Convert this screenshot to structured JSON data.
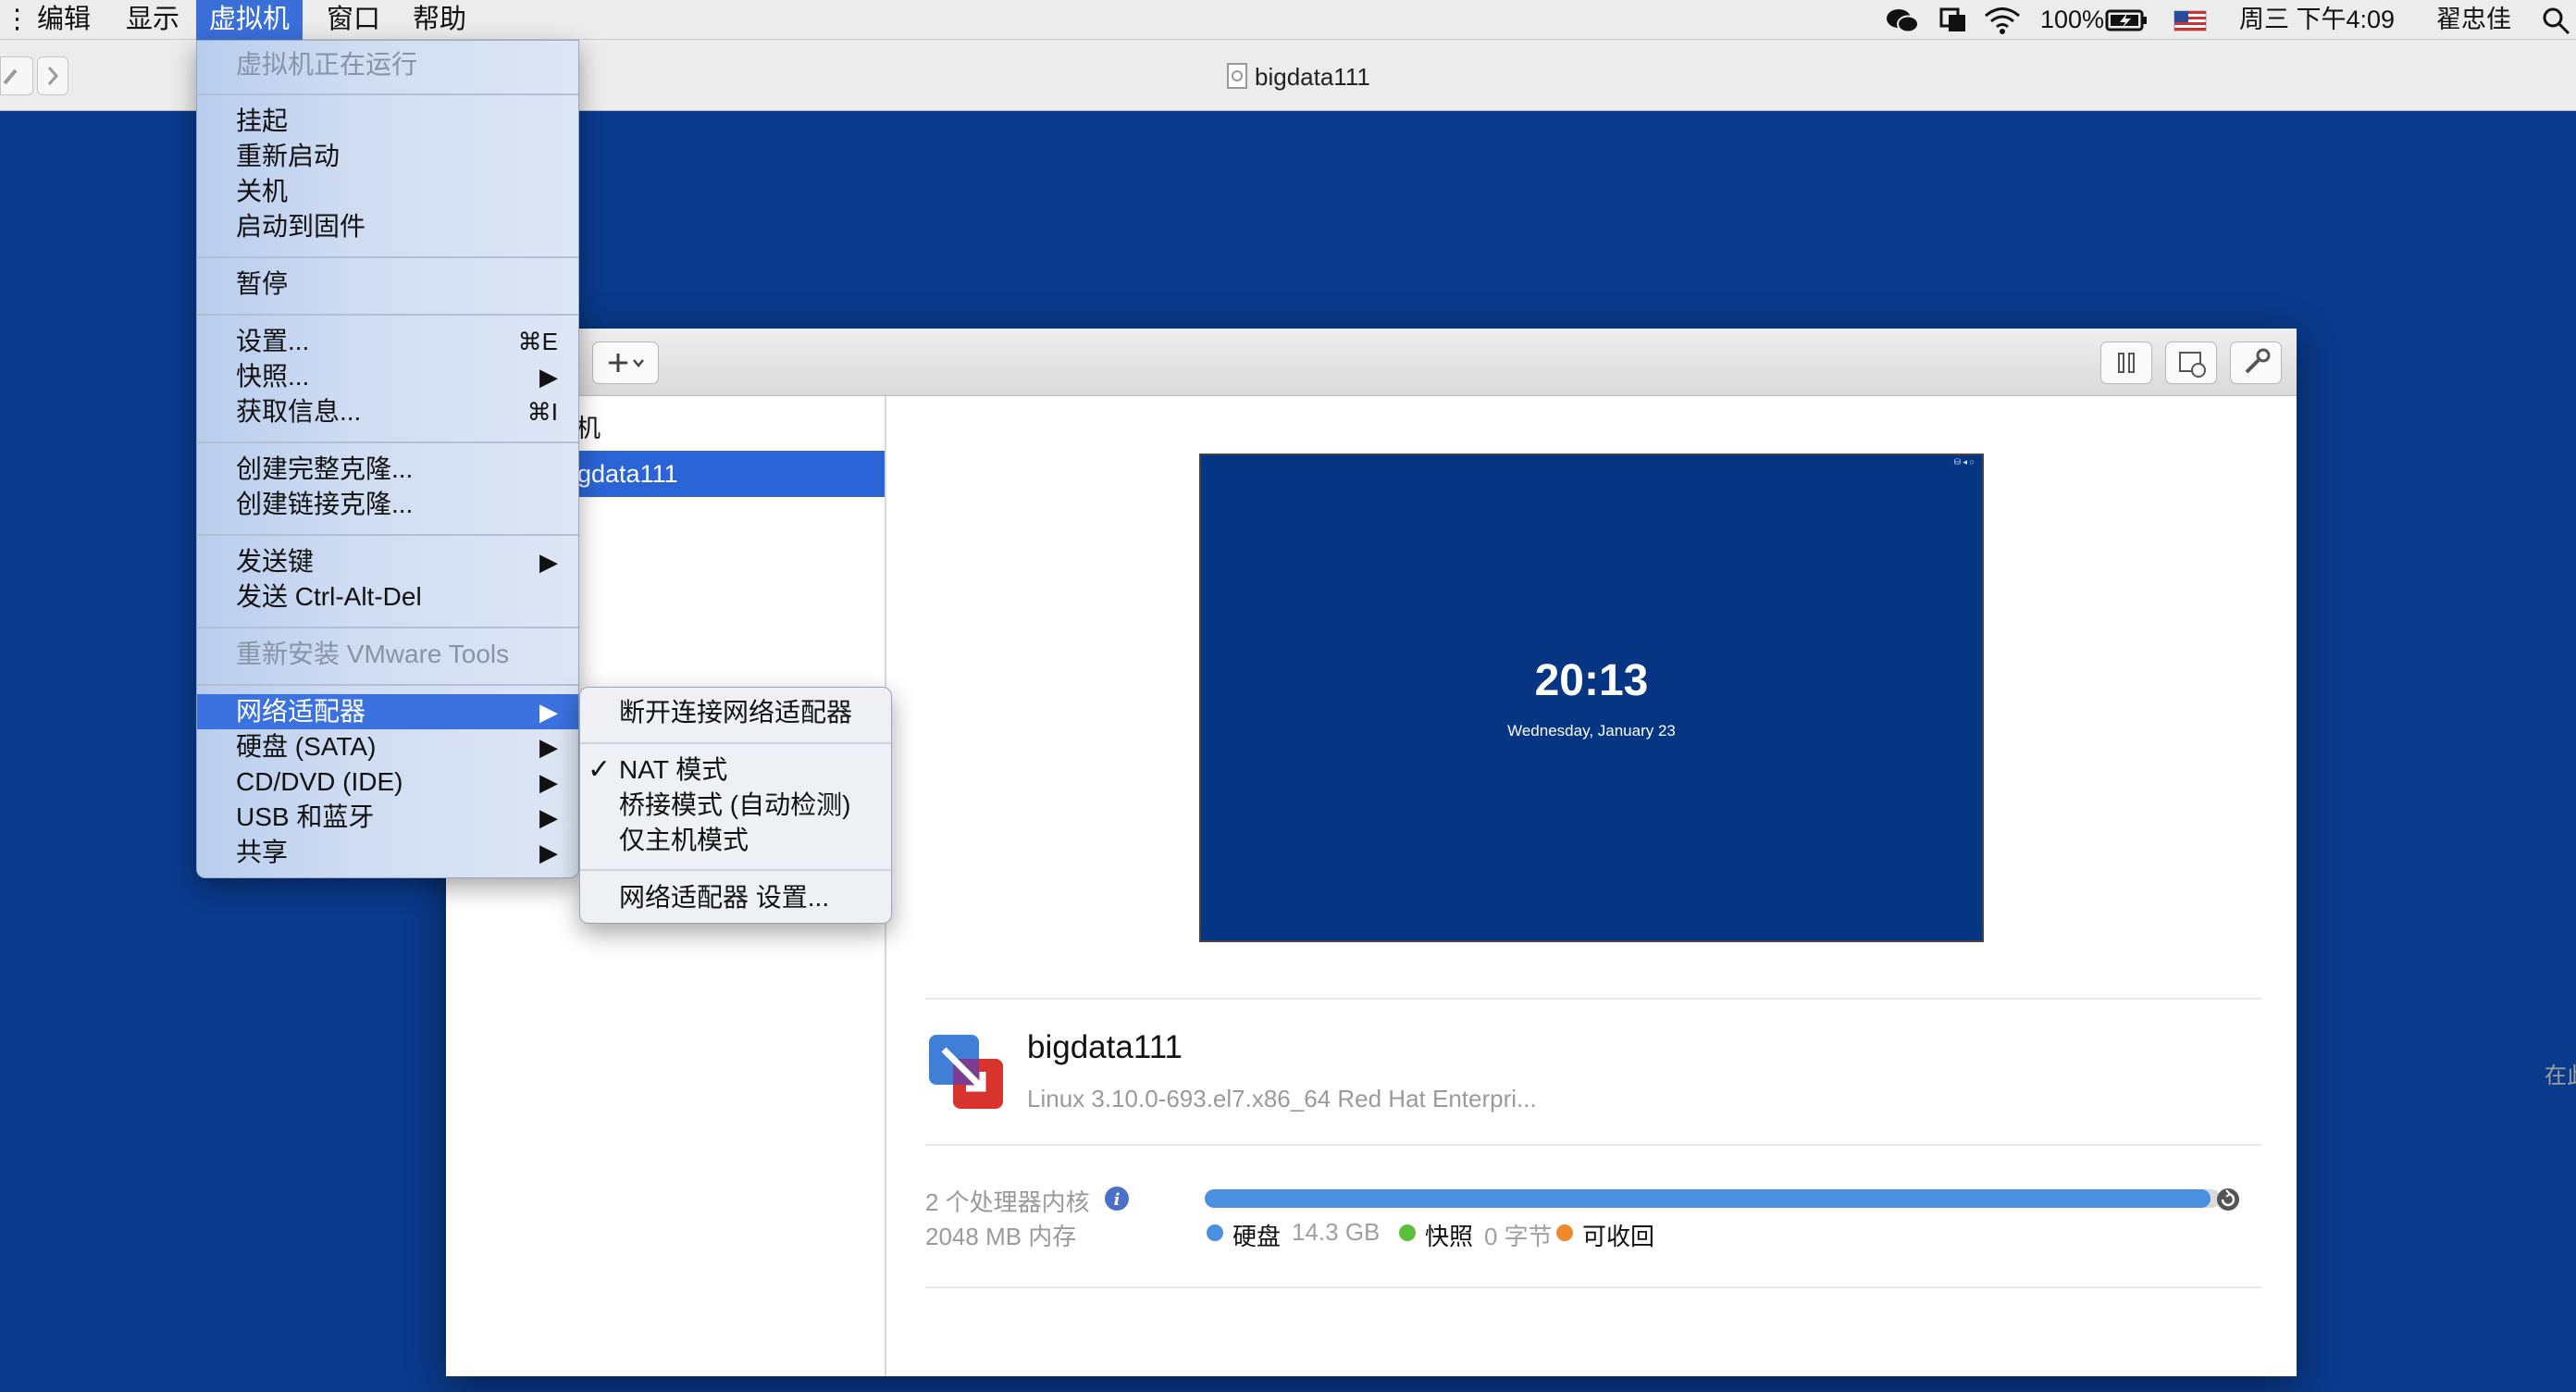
{
  "menubar": {
    "items": [
      {
        "label": "编辑"
      },
      {
        "label": "显示"
      },
      {
        "label": "虚拟机"
      },
      {
        "label": "窗口"
      },
      {
        "label": "帮助"
      }
    ],
    "battery": "100%",
    "clock": "周三 下午4:09",
    "user": "翟忠佳"
  },
  "window": {
    "title": "bigdata111"
  },
  "vm_menu": {
    "status": "虚拟机正在运行",
    "suspend": "挂起",
    "restart": "重新启动",
    "shutdown": "关机",
    "boot_firmware": "启动到固件",
    "pause": "暂停",
    "settings": "设置...",
    "settings_shortcut": "⌘E",
    "snapshots": "快照...",
    "get_info": "获取信息...",
    "get_info_shortcut": "⌘I",
    "full_clone": "创建完整克隆...",
    "linked_clone": "创建链接克隆...",
    "send_key": "发送键",
    "send_cad": "发送 Ctrl-Alt-Del",
    "reinstall_tools": "重新安装 VMware Tools",
    "network_adapter": "网络适配器",
    "hard_disk": "硬盘 (SATA)",
    "cd_dvd": "CD/DVD (IDE)",
    "usb_bt": "USB 和蓝牙",
    "sharing": "共享",
    "arrow": "▶"
  },
  "net_submenu": {
    "disconnect": "断开连接网络适配器",
    "nat": "NAT 模式",
    "nat_check": "✓",
    "bridged": "桥接模式 (自动检测)",
    "host_only": "仅主机模式",
    "settings": "网络适配器 设置..."
  },
  "library": {
    "sidebar_header": "机",
    "sidebar_selected": "gdata111",
    "preview_time": "20:13",
    "preview_date": "Wednesday, January 23",
    "vm_name": "bigdata111",
    "vm_os": "Linux 3.10.0-693.el7.x86_64 Red Hat Enterpri...",
    "add_note": "在此处添加注释",
    "cpu": "2 个处理器内核",
    "memory": "2048 MB 内存",
    "storage": {
      "disk_label": "硬盘",
      "disk_value": "14.3 GB",
      "snap_label": "快照",
      "snap_value": "0 字节",
      "reclaim_label": "可收回",
      "fill_fraction": 0.99,
      "colors": {
        "disk": "#4a8fe0",
        "snapshot": "#5cbf3a",
        "reclaimable": "#ef8a2c"
      }
    }
  }
}
